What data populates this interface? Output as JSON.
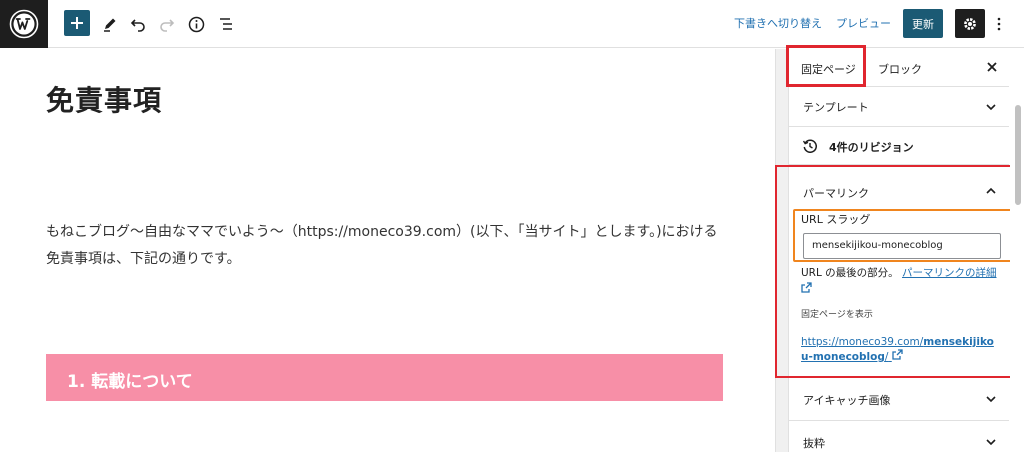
{
  "toolbar": {
    "draft_switch": "下書きへ切り替え",
    "preview": "プレビュー",
    "update": "更新"
  },
  "editor": {
    "title": "免責事項",
    "paragraph": "もねこブログ〜自由なママでいよう〜（https://moneco39.com）(以下、「当サイト」とします。)における免責事項は、下記の通りです。",
    "heading": "1. 転載について",
    "heading_color": "#f78fa7"
  },
  "sidebar": {
    "tabs": [
      "固定ページ",
      "ブロック"
    ],
    "template": "テンプレート",
    "revisions": "4件のリビジョン",
    "permalink": {
      "title": "パーマリンク",
      "slug_label": "URL スラッグ",
      "slug_value": "mensekijikou-monecoblog",
      "help_text": "URL の最後の部分。",
      "help_link": "パーマリンクの詳細",
      "view_label": "固定ページを表示",
      "url_prefix": "https://moneco39.com/",
      "url_slug": "mensekijikou-monecoblog",
      "url_suffix": "/"
    },
    "featured_image": "アイキャッチ画像",
    "excerpt": "抜粋"
  },
  "colors": {
    "highlight_red": "#e0262f",
    "highlight_orange": "#f0851e",
    "accent": "#1b5a74",
    "link": "#2271b1"
  }
}
